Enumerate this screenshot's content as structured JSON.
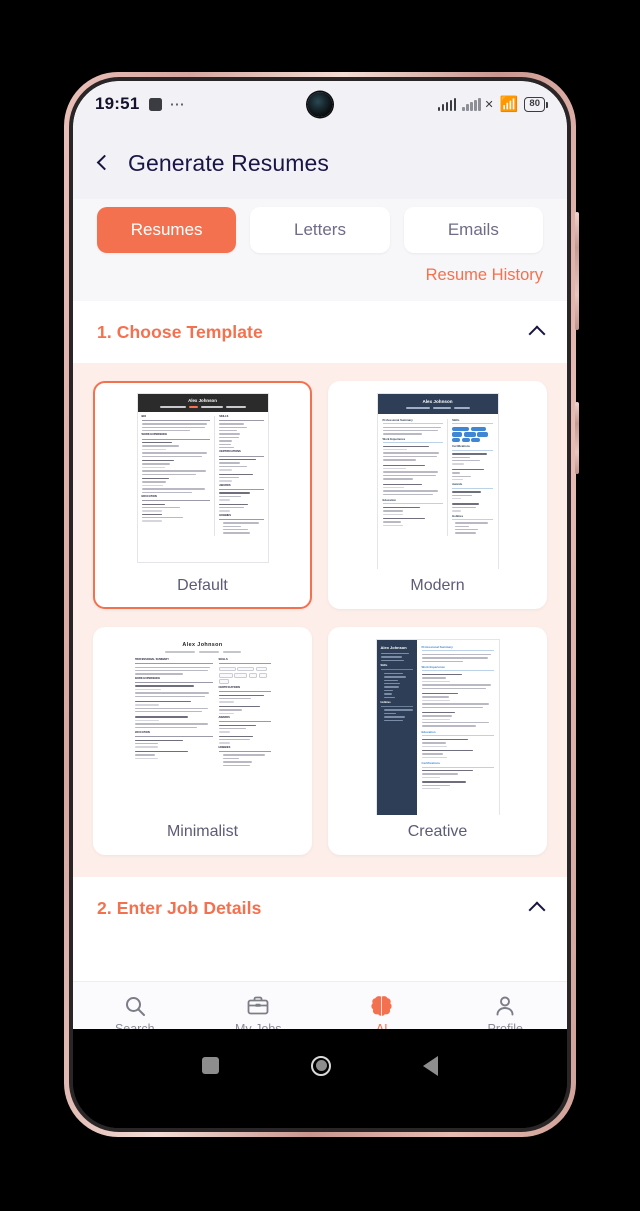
{
  "status_bar": {
    "time": "19:51",
    "battery_level": "80",
    "icons": [
      "square-icon",
      "more-dots-icon",
      "signal-icon",
      "signal-no-service-icon",
      "wifi-icon",
      "battery-icon"
    ]
  },
  "header": {
    "back_icon": "chevron-left-icon",
    "title": "Generate Resumes"
  },
  "tabs": [
    {
      "label": "Resumes",
      "active": true
    },
    {
      "label": "Letters",
      "active": false
    },
    {
      "label": "Emails",
      "active": false
    }
  ],
  "history_link": "Resume History",
  "sections": [
    {
      "number_title": "1. Choose Template",
      "expanded": true,
      "chevron": "chevron-up-icon"
    },
    {
      "number_title": "2. Enter Job Details",
      "expanded": true,
      "chevron": "chevron-up-icon"
    }
  ],
  "templates": [
    {
      "label": "Default",
      "selected": true,
      "name": "Alex Johnson",
      "style": "dark-header-two-column"
    },
    {
      "label": "Modern",
      "selected": false,
      "name": "Alex Johnson",
      "style": "navy-header-blue-pills"
    },
    {
      "label": "Minimalist",
      "selected": false,
      "name": "Alex Johnson",
      "style": "plain-centered"
    },
    {
      "label": "Creative",
      "selected": false,
      "name": "Alex Johnson",
      "style": "navy-sidebar"
    }
  ],
  "resume_sections": {
    "default_left": [
      "BIO",
      "WORK EXPERIENCE",
      "EDUCATION"
    ],
    "default_right": [
      "SKILLS",
      "CERTIFICATIONS",
      "AWARDS",
      "HOBBIES"
    ],
    "modern_left": [
      "Professional Summary",
      "Work Experience",
      "Education"
    ],
    "modern_right": [
      "Skills",
      "Certifications",
      "Awards",
      "Hobbies"
    ],
    "minimal_left": [
      "PROFESSIONAL SUMMARY",
      "WORK EXPERIENCE",
      "EDUCATION"
    ],
    "minimal_right": [
      "SKILLS",
      "CERTIFICATIONS",
      "AWARDS",
      "HOBBIES"
    ],
    "creative_side": [
      "Skills",
      "Hobbies"
    ],
    "creative_body": [
      "Professional Summary",
      "Work Experience",
      "Education",
      "Certifications"
    ]
  },
  "bottom_nav": [
    {
      "label": "Search",
      "icon": "search-icon",
      "active": false
    },
    {
      "label": "My Jobs",
      "icon": "briefcase-icon",
      "active": false
    },
    {
      "label": "AI",
      "icon": "brain-icon",
      "active": true
    },
    {
      "label": "Profile",
      "icon": "person-icon",
      "active": false
    }
  ],
  "android_nav": [
    {
      "name": "recents-button",
      "icon": "square-icon"
    },
    {
      "name": "home-button",
      "icon": "circle-icon"
    },
    {
      "name": "back-button",
      "icon": "triangle-left-icon"
    }
  ],
  "colors": {
    "accent": "#f4714f",
    "title": "#1a1545",
    "panel_bg": "#fdeee9",
    "navy": "#2d3e56",
    "blue": "#3f86d4"
  }
}
